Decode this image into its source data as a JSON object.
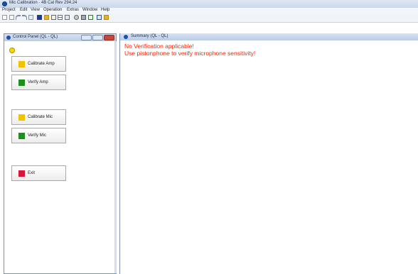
{
  "app": {
    "title": "Mic Calibration · 4B Cal Rev 294.24"
  },
  "menu": [
    "Project",
    "Edit",
    "View",
    "Operation",
    "Extras",
    "Window",
    "Help"
  ],
  "toolbar": {
    "icons": [
      "new-icon",
      "open-icon",
      "undo-icon",
      "redo-icon",
      "copy-icon",
      "save-icon",
      "folder-icon",
      "print-icon",
      "table-icon",
      "grid-icon",
      "settings-icon",
      "image-icon",
      "check-icon",
      "chart-icon",
      "folder-icon"
    ],
    "colors": {
      "save": "#1f3d8a",
      "folder": "#e0b12a"
    }
  },
  "control_panel": {
    "title": "Control Panel (QL - QL)",
    "status_light_color": "#ffd800",
    "buttons": [
      {
        "label": "Calibrate Amp",
        "color": "#f2c200"
      },
      {
        "label": "Verify Amp",
        "color": "#1e8f1e"
      },
      {
        "label": "Calibrate Mic",
        "color": "#f2c200"
      },
      {
        "label": "Verify Mic",
        "color": "#1e8f1e"
      },
      {
        "label": "Exit",
        "color": "#d8163a"
      }
    ]
  },
  "summary": {
    "title": "Summary (QL - QL)",
    "messages": [
      "No Verification applicable!",
      "Use pistonphone to verify microphone sensitivity!"
    ],
    "message_color": "#ff2200"
  }
}
